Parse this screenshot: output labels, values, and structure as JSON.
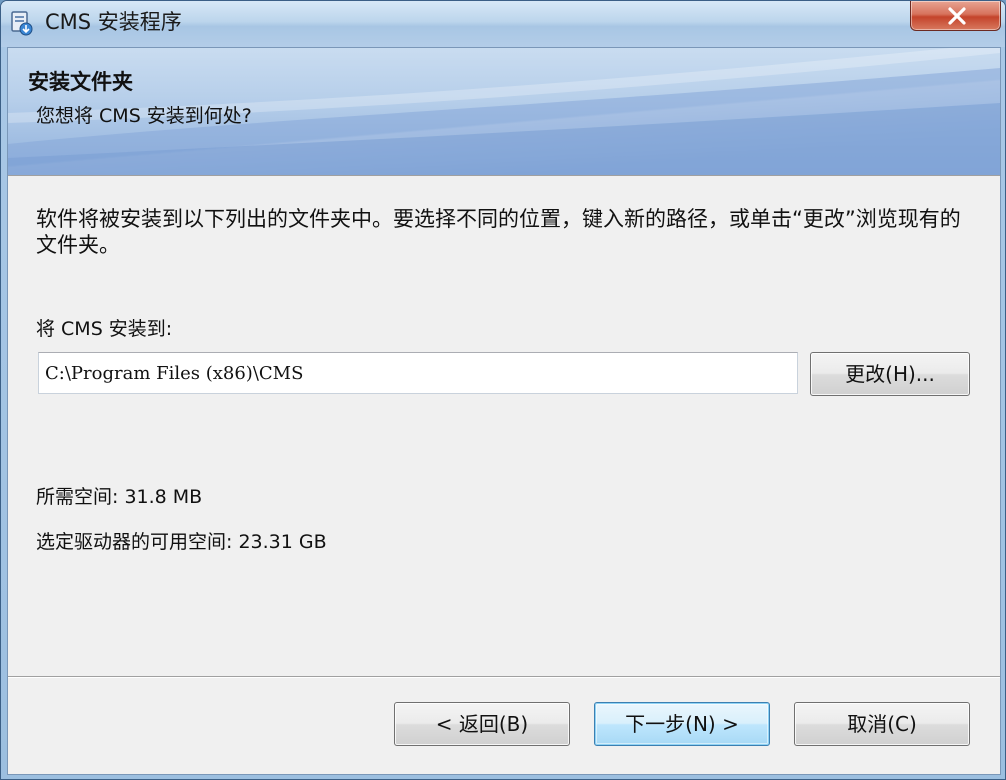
{
  "window": {
    "title": "CMS 安装程序"
  },
  "banner": {
    "title": "安装文件夹",
    "subtitle": "您想将 CMS 安装到何处?"
  },
  "content": {
    "description": "软件将被安装到以下列出的文件夹中。要选择不同的位置，键入新的路径，或单击“更改”浏览现有的文件夹。",
    "install_label": "将 CMS 安装到:",
    "install_path": "C:\\Program Files (x86)\\CMS",
    "change_button": "更改(H)...",
    "space_required": "所需空间: 31.8 MB",
    "space_available": "选定驱动器的可用空间: 23.31 GB"
  },
  "footer": {
    "back_button": "< 返回(B)",
    "next_button": "下一步(N) >",
    "cancel_button": "取消(C)"
  },
  "colors": {
    "accent": "#3c7fb1",
    "close": "#c4442b",
    "dialog_bg": "#f0f0f0"
  },
  "icons": {
    "app": "installer-package-icon",
    "close": "close-icon"
  }
}
